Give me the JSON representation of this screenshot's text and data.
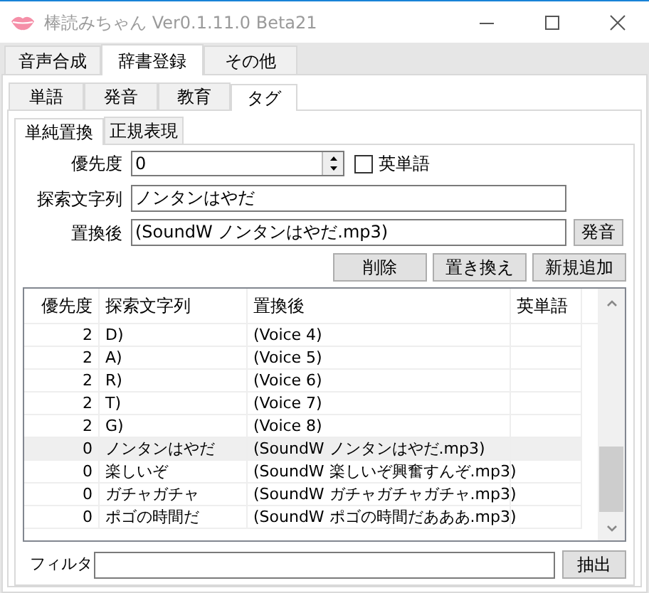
{
  "window": {
    "title": "棒読みちゃん Ver0.1.11.0 Beta21"
  },
  "main_tabs": [
    {
      "label": "音声合成",
      "selected": false
    },
    {
      "label": "辞書登録",
      "selected": true
    },
    {
      "label": "その他",
      "selected": false
    }
  ],
  "dict_tabs": [
    {
      "label": "単語",
      "selected": false
    },
    {
      "label": "発音",
      "selected": false
    },
    {
      "label": "教育",
      "selected": false
    },
    {
      "label": "タグ",
      "selected": true
    }
  ],
  "tag_tabs": [
    {
      "label": "単純置換",
      "selected": true
    },
    {
      "label": "正規表現",
      "selected": false
    }
  ],
  "form": {
    "priority": {
      "label": "優先度",
      "value": "0"
    },
    "english_word": {
      "label": "英単語",
      "checked": false
    },
    "search": {
      "label": "探索文字列",
      "value": "ノンタンはやだ"
    },
    "replace": {
      "label": "置換後",
      "value": "(SoundW ノンタンはやだ.mp3)"
    },
    "pronounce_button": "発音",
    "buttons": [
      "削除",
      "置き換え",
      "新規追加"
    ]
  },
  "table": {
    "columns": [
      "優先度",
      "探索文字列",
      "置換後",
      "英単語"
    ],
    "rows": [
      {
        "cells": [
          "2",
          "D)",
          "(Voice 4)"
        ],
        "selected": false
      },
      {
        "cells": [
          "2",
          "A)",
          "(Voice 5)"
        ],
        "selected": false
      },
      {
        "cells": [
          "2",
          "R)",
          "(Voice 6)"
        ],
        "selected": false
      },
      {
        "cells": [
          "2",
          "T)",
          "(Voice 7)"
        ],
        "selected": false
      },
      {
        "cells": [
          "2",
          "G)",
          "(Voice 8)"
        ],
        "selected": false
      },
      {
        "cells": [
          "0",
          "ノンタンはやだ",
          "(SoundW ノンタンはやだ.mp3)"
        ],
        "selected": true
      },
      {
        "cells": [
          "0",
          "楽しいぞ",
          "(SoundW 楽しいぞ興奮すんぞ.mp3)"
        ],
        "selected": false
      },
      {
        "cells": [
          "0",
          "ガチャガチャ",
          "(SoundW ガチャガチャガチャ.mp3)"
        ],
        "selected": false
      },
      {
        "cells": [
          "0",
          "ポゴの時間だ",
          "(SoundW ポゴの時間だあああ.mp3)"
        ],
        "selected": false
      }
    ]
  },
  "filter": {
    "label": "フィルタ",
    "button": "抽出"
  }
}
